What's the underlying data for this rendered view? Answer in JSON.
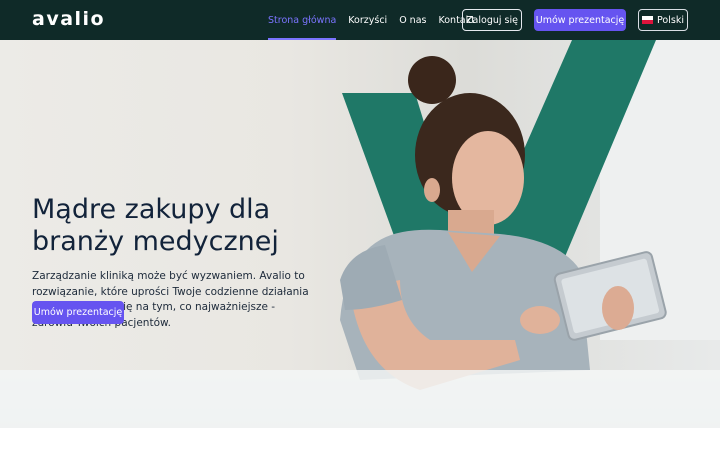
{
  "nav": {
    "logo": "avalio",
    "links": [
      "Strona główna",
      "Korzyści",
      "O nas",
      "Kontakt"
    ],
    "login": "Zaloguj się",
    "demo": "Umów prezentację",
    "lang": "Polski"
  },
  "hero": {
    "title_line1": "Mądre zakupy dla",
    "title_line2": "branży medycznej",
    "description": "Zarządzanie kliniką może być wyzwaniem. Avalio to rozwiązanie, które uprości Twoje codzienne działania i pozwoli skupić się na tym, co najważniejsze - zdrowiu Twoich pacjentów.",
    "cta": "Umów prezentację"
  },
  "colors": {
    "nav_bg": "#0f2a28",
    "accent": "#6654f0",
    "active_link": "#7b74ff",
    "brand_green": "#1f7867"
  },
  "icons": {
    "flag": "poland-flag-icon"
  }
}
